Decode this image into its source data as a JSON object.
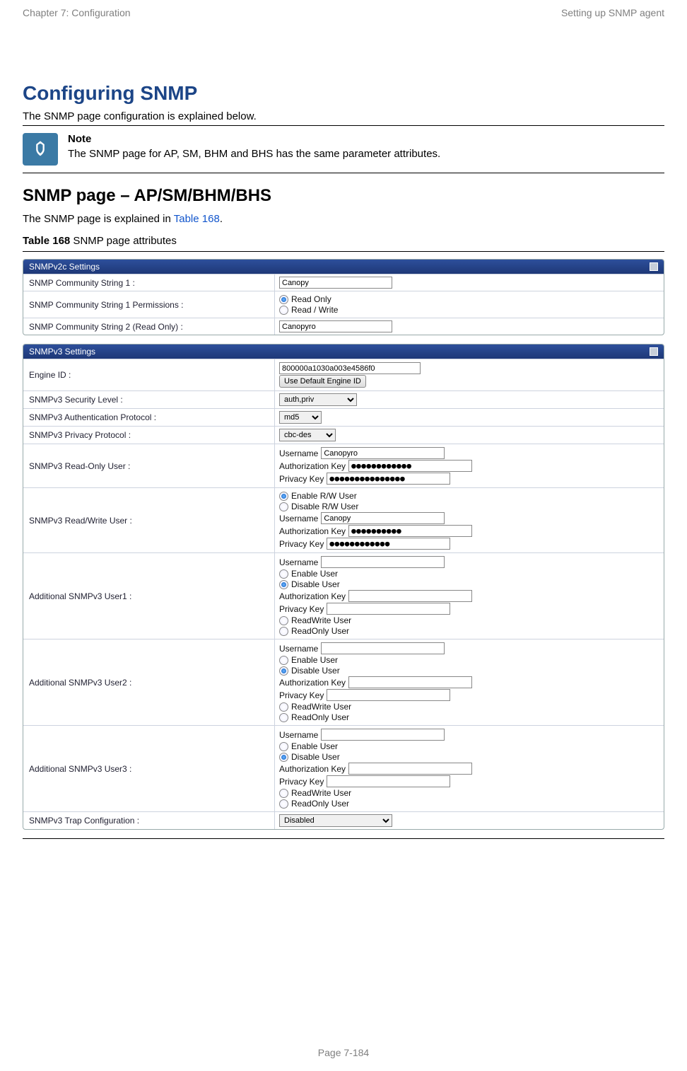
{
  "header": {
    "left": "Chapter 7:  Configuration",
    "right": "Setting up SNMP agent"
  },
  "title": "Configuring SNMP",
  "intro": "The SNMP page configuration is explained below.",
  "note": {
    "title": "Note",
    "text": "The SNMP page for AP, SM, BHM and BHS has the same parameter attributes."
  },
  "subhead": "SNMP page – AP/SM/BHM/BHS",
  "explain_pre": "The SNMP page is explained in ",
  "explain_link": "Table 168",
  "explain_post": ".",
  "table_caption_bold": "Table 168",
  "table_caption_rest": " SNMP page attributes",
  "footer": "Page 7-184",
  "v2c": {
    "panel_title": "SNMPv2c Settings",
    "r1_label": "SNMP Community String 1 :",
    "r1_value": "Canopy",
    "r2_label": "SNMP Community String 1 Permissions :",
    "r2_opt1": "Read Only",
    "r2_opt2": "Read / Write",
    "r3_label": "SNMP Community String 2 (Read Only) :",
    "r3_value": "Canopyro"
  },
  "v3": {
    "panel_title": "SNMPv3 Settings",
    "engine_label": "Engine ID :",
    "engine_value": "800000a1030a003e4586f0",
    "engine_btn": "Use Default Engine ID",
    "sec_label": "SNMPv3 Security Level :",
    "sec_value": "auth,priv",
    "auth_label": "SNMPv3 Authentication Protocol :",
    "auth_value": "md5",
    "priv_label": "SNMPv3 Privacy Protocol :",
    "priv_value": "cbc-des",
    "ro_label": "SNMPv3 Read-Only User :",
    "ro_user_lbl": "Username",
    "ro_user_val": "Canopyro",
    "ro_auth_lbl": "Authorization Key",
    "ro_auth_val": "●●●●●●●●●●●●",
    "ro_priv_lbl": "Privacy Key",
    "ro_priv_val": "●●●●●●●●●●●●●●●",
    "rw_label": "SNMPv3 Read/Write User :",
    "rw_opt_en": "Enable R/W User",
    "rw_opt_dis": "Disable R/W User",
    "rw_user_lbl": "Username",
    "rw_user_val": "Canopy",
    "rw_auth_lbl": "Authorization Key",
    "rw_auth_val": "●●●●●●●●●●",
    "rw_priv_lbl": "Privacy Key",
    "rw_priv_val": "●●●●●●●●●●●●",
    "add1_label": "Additional SNMPv3 User1 :",
    "add2_label": "Additional SNMPv3 User2 :",
    "add3_label": "Additional SNMPv3 User3 :",
    "add_user_lbl": "Username",
    "add_en": "Enable User",
    "add_dis": "Disable User",
    "add_auth_lbl": "Authorization Key",
    "add_priv_lbl": "Privacy Key",
    "add_rw": "ReadWrite User",
    "add_ro": "ReadOnly User",
    "trap_label": "SNMPv3 Trap Configuration :",
    "trap_value": "Disabled"
  }
}
